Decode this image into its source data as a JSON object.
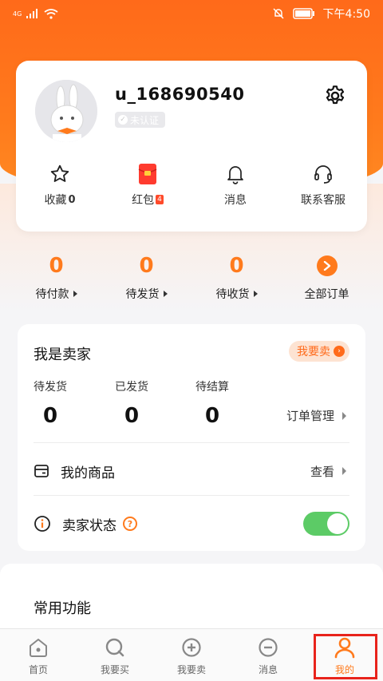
{
  "status_bar": {
    "network": "4G",
    "time": "下午4:50"
  },
  "profile": {
    "username": "u_168690540",
    "verify_status": "未认证",
    "quick_items": [
      {
        "label": "收藏",
        "count": "0",
        "icon": "star-icon"
      },
      {
        "label": "红包",
        "badge": "4",
        "icon": "red-packet-icon"
      },
      {
        "label": "消息",
        "icon": "bell-icon"
      },
      {
        "label": "联系客服",
        "icon": "headset-icon"
      }
    ]
  },
  "orders": [
    {
      "label": "待付款",
      "count": "0"
    },
    {
      "label": "待发货",
      "count": "0"
    },
    {
      "label": "待收货",
      "count": "0"
    },
    {
      "label": "全部订单"
    }
  ],
  "seller": {
    "title": "我是卖家",
    "sell_button": "我要卖",
    "stats": [
      {
        "label": "待发货",
        "value": "0"
      },
      {
        "label": "已发货",
        "value": "0"
      },
      {
        "label": "待结算",
        "value": "0"
      }
    ],
    "order_management": "订单管理",
    "my_products": {
      "label": "我的商品",
      "action": "查看"
    },
    "seller_status": {
      "label": "卖家状态",
      "enabled": true
    }
  },
  "common": {
    "title": "常用功能"
  },
  "tabbar": [
    {
      "label": "首页",
      "icon": "home-icon"
    },
    {
      "label": "我要买",
      "icon": "search-buy-icon"
    },
    {
      "label": "我要卖",
      "icon": "plus-circle-icon"
    },
    {
      "label": "消息",
      "icon": "message-icon"
    },
    {
      "label": "我的",
      "icon": "person-icon",
      "active": true
    }
  ],
  "colors": {
    "brand": "#ff7a1c",
    "highlight": "#e8231b",
    "toggle_on": "#5ccb66"
  }
}
